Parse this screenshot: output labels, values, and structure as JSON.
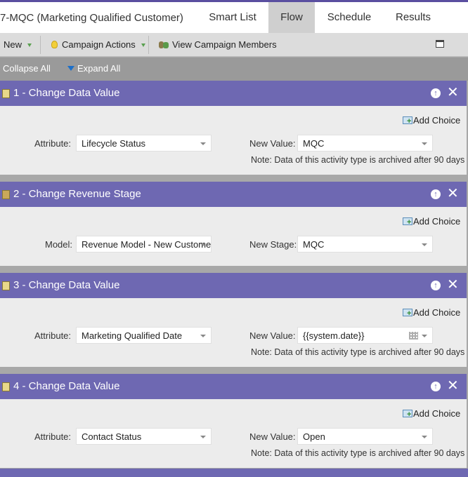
{
  "campaign": {
    "title": "7-MQC (Marketing Qualified Customer)"
  },
  "tabs": [
    {
      "label": "Smart List",
      "active": false
    },
    {
      "label": "Flow",
      "active": true
    },
    {
      "label": "Schedule",
      "active": false
    },
    {
      "label": "Results",
      "active": false
    }
  ],
  "toolbar": {
    "new_label": "New",
    "campaign_actions_label": "Campaign Actions",
    "view_members_label": "View Campaign Members"
  },
  "expand_bar": {
    "collapse_label": "Collapse All",
    "expand_label": "Expand All"
  },
  "add_choice_label": "Add Choice",
  "steps": [
    {
      "title": "1 - Change Data Value",
      "field1_label": "Attribute:",
      "field1_value": "Lifecycle Status",
      "field2_label": "New Value:",
      "field2_value": "MQC",
      "note": "Note: Data of this activity type is archived after 90 days"
    },
    {
      "title": "2 - Change Revenue Stage",
      "field1_label": "Model:",
      "field1_value": "Revenue Model - New Customer",
      "field2_label": "New Stage:",
      "field2_value": "MQC",
      "note": ""
    },
    {
      "title": "3 - Change Data Value",
      "field1_label": "Attribute:",
      "field1_value": "Marketing Qualified Date",
      "field2_label": "New Value:",
      "field2_value": "{{system.date}}",
      "note": "Note: Data of this activity type is archived after 90 days"
    },
    {
      "title": "4 - Change Data Value",
      "field1_label": "Attribute:",
      "field1_value": "Contact Status",
      "field2_label": "New Value:",
      "field2_value": "Open",
      "note": "Note: Data of this activity type is archived after 90 days"
    }
  ]
}
